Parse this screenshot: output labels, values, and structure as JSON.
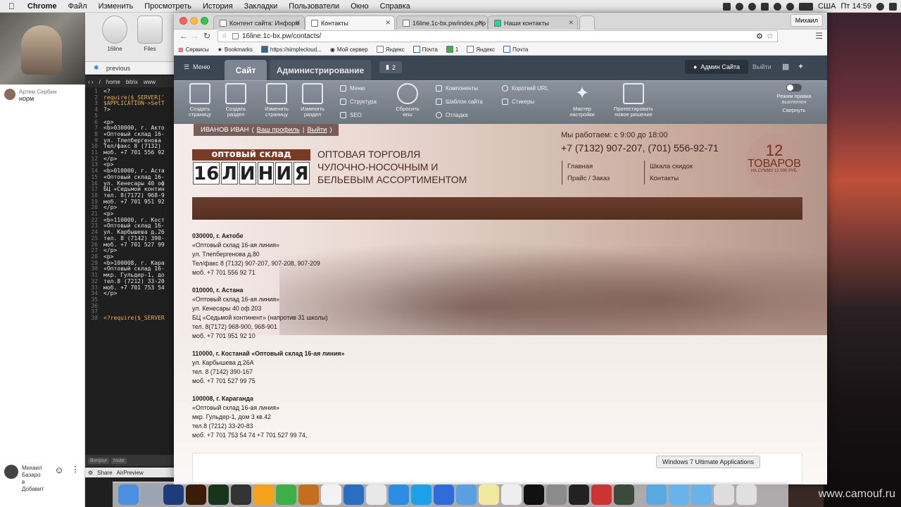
{
  "menubar": {
    "app": "Chrome",
    "items": [
      "Файл",
      "Изменить",
      "Просмотреть",
      "История",
      "Закладки",
      "Пользователи",
      "Окно",
      "Справка"
    ],
    "locale": "США",
    "clock": "Пт 14:59"
  },
  "chat": {
    "messages": [
      {
        "author": "Артем Сербин",
        "text": "норм"
      }
    ],
    "bottom_user": {
      "lines": [
        "Михаил",
        "Базаро",
        "в",
        "Добавит"
      ]
    }
  },
  "editor": {
    "tiles": [
      "16line",
      "Files"
    ],
    "search_value": "previous",
    "path": [
      "home",
      "bitrix",
      "www"
    ],
    "lines": [
      {
        "n": "1",
        "t": "<?"
      },
      {
        "n": "2",
        "t": "require($_SERVER['"
      },
      {
        "n": "3",
        "t": "$APPLICATION->SetT"
      },
      {
        "n": "4",
        "t": "?>"
      },
      {
        "n": "5",
        "t": ""
      },
      {
        "n": "6",
        "t": "<p>"
      },
      {
        "n": "7",
        "t": "<b>030000, г. Акто"
      },
      {
        "n": "8",
        "t": "«Оптовый склад 16-"
      },
      {
        "n": "9",
        "t": "ул. Тлепбергенова"
      },
      {
        "n": "10",
        "t": "Тел/факс 8 (7132)"
      },
      {
        "n": "11",
        "t": "моб. +7 701 556 92"
      },
      {
        "n": "12",
        "t": "</p>"
      },
      {
        "n": "13",
        "t": "<p>"
      },
      {
        "n": "14",
        "t": "<b>010000, г. Аста"
      },
      {
        "n": "15",
        "t": "«Оптовый склад 16-"
      },
      {
        "n": "16",
        "t": "ул. Кенесары 40 оф"
      },
      {
        "n": "17",
        "t": "БЦ «Седьмой контин"
      },
      {
        "n": "18",
        "t": "тел. 8(7172) 968-9"
      },
      {
        "n": "19",
        "t": "моб. +7 701 951 92"
      },
      {
        "n": "20",
        "t": "</p>"
      },
      {
        "n": "21",
        "t": "<p>"
      },
      {
        "n": "22",
        "t": "<b>110000, г. Кост"
      },
      {
        "n": "23",
        "t": "«Оптовый склад 16-"
      },
      {
        "n": "24",
        "t": "ул. Карбышева д.26"
      },
      {
        "n": "25",
        "t": "тел. 8 (7142) 390-"
      },
      {
        "n": "26",
        "t": "моб. +7 701 527 99"
      },
      {
        "n": "27",
        "t": "</p>"
      },
      {
        "n": "28",
        "t": "<p>"
      },
      {
        "n": "29",
        "t": "<b>100008, г. Кара"
      },
      {
        "n": "30",
        "t": "«Оптовый склад 16-"
      },
      {
        "n": "31",
        "t": "мкр. Гульдер-1, до"
      },
      {
        "n": "32",
        "t": "тел.8 (7212) 33-20"
      },
      {
        "n": "33",
        "t": "моб. +7 701 753 54"
      },
      {
        "n": "34",
        "t": "</p>"
      },
      {
        "n": "35",
        "t": ""
      },
      {
        "n": "36",
        "t": ""
      },
      {
        "n": "37",
        "t": ""
      },
      {
        "n": "38",
        "t": "<?require($_SERVER"
      }
    ],
    "footer_tags": [
      "Bonjour",
      "mute"
    ],
    "bottom": {
      "share": "Share",
      "preview": "AirPreview"
    }
  },
  "browser": {
    "tabs": [
      {
        "label": "Контент сайта: Информ"
      },
      {
        "label": "Контакты",
        "active": true
      },
      {
        "label": "16line.1c-bx.pw/index.php"
      },
      {
        "label": "Наши контакты"
      }
    ],
    "user_chip": "Михаил",
    "url": "16line.1c-bx.pw/contacts/",
    "bookmarks": [
      "Сервисы",
      "Bookmarks",
      "https://simplecloud...",
      "Мой сервер",
      "Яндекс",
      "Почта",
      "1",
      "Яндекс",
      "Почта"
    ]
  },
  "bitrix": {
    "menu": "Меню",
    "tab_site": "Сайт",
    "tab_admin": "Администрирование",
    "notifications": "2",
    "admin_user": "Админ Сайта",
    "logout": "Выйти",
    "tools": [
      {
        "label": "Создать страницу"
      },
      {
        "label": "Создать раздел"
      },
      {
        "label": "Изменить страницу"
      },
      {
        "label": "Изменить раздел"
      },
      {
        "label": "Сбросить кеш"
      },
      {
        "label": "Мастер настройки"
      },
      {
        "label": "Протестировать новое решение"
      }
    ],
    "links_col1": [
      "Меню",
      "Структура",
      "SEO"
    ],
    "links_col2": [
      "Компоненты",
      "Шаблон сайта",
      "Отладка"
    ],
    "links_col3": [
      "Короткий URL",
      "Стикеры"
    ],
    "edit_mode": "Режим правки",
    "edit_mode_state": "выключен",
    "collapse": "Свернуть"
  },
  "site": {
    "user_name": "ИВАНОВ ИВАН",
    "profile_link": "Ваш профиль",
    "logout_link": "Выйти",
    "logo_top": "оптовый склад",
    "logo_digits": [
      "16",
      "Л",
      "И",
      "Н",
      "И",
      "Я"
    ],
    "tagline": [
      "Оптовая торговля",
      "чулочно-носочным и",
      "бельевым ассортиментом"
    ],
    "worktime": "Мы работаем: с 9:00 до 18:00",
    "phones": "+7 (7132) 907-207, (701) 556-92-71",
    "nav_col1": [
      "Главная",
      "Прайс / Заказ"
    ],
    "nav_col2": [
      "Шкала скидок",
      "Контакты"
    ],
    "cart": {
      "count": "12",
      "word": "ТОВАРОВ",
      "sum": "НА СУММУ 12 000 РУБ."
    },
    "offices": [
      {
        "head": "030000, г. Актобе",
        "lines": [
          "«Оптовый склад 16-ая линия»",
          "ул. Тлепбергенова д.80",
          "Тел/факс 8 (7132) 907-207, 907-208, 907-209",
          "моб. +7 701 556 92 71"
        ]
      },
      {
        "head": "010000, г. Астана",
        "lines": [
          "«Оптовый склад 16-ая линия»",
          "ул. Кенесары 40 оф 203",
          "БЦ «Седьмой континент» (напротив 31 школы)",
          "тел. 8(7172) 968-900, 968-901",
          "моб. +7 701 951 92 10"
        ]
      },
      {
        "head": "110000, г. Костанай «Оптовый склад 16-ая линия»",
        "lines": [
          "ул. Карбышева д.26А",
          "тел. 8 (7142) 390-167",
          "моб. +7 701 527 99 75"
        ]
      },
      {
        "head": "100008, г. Караганда",
        "lines": [
          "«Оптовый склад 16-ая линия»",
          "мкр. Гульдер-1, дом 3 кв.42",
          "тел.8 (7212) 33-20-83",
          "моб. +7 701 753 54 74 +7 701 527 99 74,"
        ]
      }
    ]
  },
  "tooltip": "Windows 7 Ultimate Applications",
  "watermark": "www.camouf.ru",
  "dock_apps": [
    "Finder",
    "Launchpad",
    "Photoshop",
    "Illustrator",
    "Dreamweaver",
    "Final Cut",
    "Sketch",
    "Leaf",
    "Sublime",
    "Smile",
    "QuickTime",
    "Chrome",
    "Safari",
    "Skype",
    "Messages",
    "iPhoto",
    "Notes",
    "Reminders",
    "Terminal",
    "System Preferences",
    "OBS",
    "Parallels",
    "Screen",
    "Downloads",
    "Folder",
    "Folder",
    "Display",
    "Trash"
  ]
}
